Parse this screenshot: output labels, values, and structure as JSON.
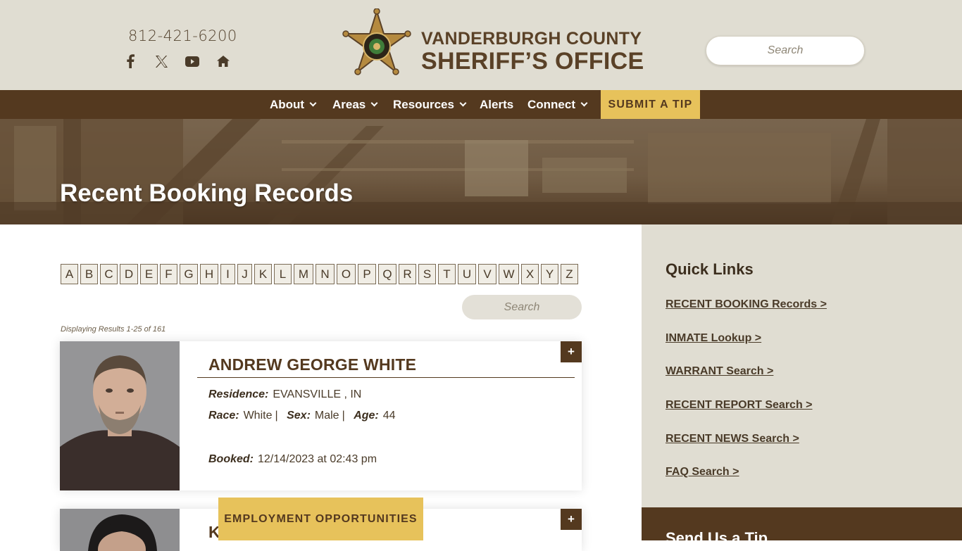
{
  "header": {
    "phone": "812-421-6200",
    "social_icons": [
      "facebook-icon",
      "x-icon",
      "youtube-icon",
      "nextdoor-icon"
    ],
    "logo_line1": "VANDERBURGH COUNTY",
    "logo_line2": "SHERIFF’S OFFICE",
    "search_placeholder": "Search"
  },
  "nav": {
    "items": [
      {
        "label": "About",
        "has_dropdown": true
      },
      {
        "label": "Areas",
        "has_dropdown": true
      },
      {
        "label": "Resources",
        "has_dropdown": true
      },
      {
        "label": "Alerts",
        "has_dropdown": false
      },
      {
        "label": "Connect",
        "has_dropdown": true
      }
    ],
    "tip_button": "SUBMIT A TIP"
  },
  "hero": {
    "title": "Recent Booking Records"
  },
  "alphabet": [
    "A",
    "B",
    "C",
    "D",
    "E",
    "F",
    "G",
    "H",
    "I",
    "J",
    "K",
    "L",
    "M",
    "N",
    "O",
    "P",
    "Q",
    "R",
    "S",
    "T",
    "U",
    "V",
    "W",
    "X",
    "Y",
    "Z"
  ],
  "content": {
    "search_placeholder": "Search",
    "results_text": "Displaying Results 1-25 of 161"
  },
  "records": [
    {
      "name": "ANDREW GEORGE WHITE",
      "residence_label": "Residence:",
      "residence": "EVANSVILLE , IN",
      "race_label": "Race:",
      "race": "White",
      "sex_label": "Sex:",
      "sex": "Male",
      "age_label": "Age:",
      "age": "44",
      "booked_label": "Booked:",
      "booked": "12/14/2023 at 02:43 pm",
      "plus": "+"
    },
    {
      "name_partial": "K",
      "plus": "+"
    }
  ],
  "floating_button": "EMPLOYMENT OPPORTUNITIES",
  "sidebar": {
    "title": "Quick Links",
    "links": [
      "RECENT BOOKING Records >",
      "INMATE Lookup >",
      "WARRANT Search >",
      "RECENT REPORT Search >",
      "RECENT NEWS Search >",
      "FAQ Search >"
    ],
    "tip_title": "Send Us a Tip"
  },
  "colors": {
    "brown": "#54391f",
    "gold": "#e7c25b",
    "beige": "#e0ddd2"
  }
}
